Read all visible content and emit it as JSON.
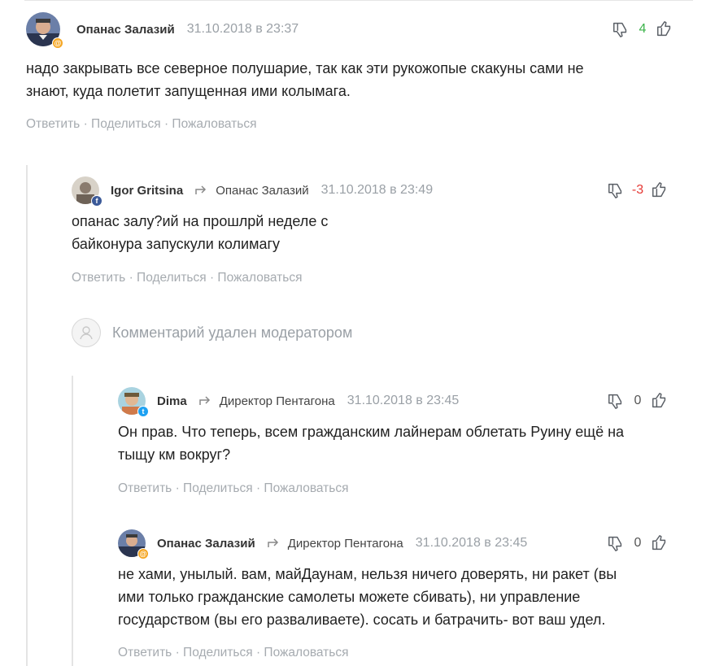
{
  "comments": [
    {
      "author": "Опанас Залазий",
      "reply_to": "",
      "time": "31.10.2018 в 23:37",
      "score": "4",
      "text_lines": [
        "надо закрывать все северное полушарие, так как эти рукожопые скакуны сами не",
        "знают, куда полетит запущенная ими колымага."
      ],
      "badge": "@"
    },
    {
      "author": "Igor Gritsina",
      "reply_to": "Опанас Залазий",
      "time": "31.10.2018 в 23:49",
      "score": "-3",
      "text_lines": [
        "опанас залу?ий на прошлрй неделе с",
        "байконура запускули колимагу"
      ],
      "badge": "f"
    },
    {
      "author": "Dima",
      "reply_to": "Директор Пентагона",
      "time": "31.10.2018 в 23:45",
      "score": "0",
      "text_lines": [
        "Он прав. Что теперь, всем гражданским лайнерам облетать Руину ещё на",
        "тыщу км вокруг?"
      ],
      "badge": "t"
    },
    {
      "author": "Опанас Залазий",
      "reply_to": "Директор Пентагона",
      "time": "31.10.2018 в 23:45",
      "score": "0",
      "text_lines": [
        "не хами, унылый. вам, майДаунам, нельзя ничего доверять, ни ракет (вы",
        "ими только гражданские самолеты можете сбивать), ни управление",
        "государством (вы его разваливаете). сосать и батрачить- вот ваш удел."
      ],
      "badge": "@"
    }
  ],
  "actions": {
    "reply": "Ответить",
    "share": "Поделиться",
    "report": "Пожаловаться",
    "sep": " · "
  },
  "deleted": {
    "text": "Комментарий удален модератором"
  },
  "colors": {
    "positive": "#3bb34a",
    "negative": "#e53935",
    "muted": "#a6abb0"
  }
}
